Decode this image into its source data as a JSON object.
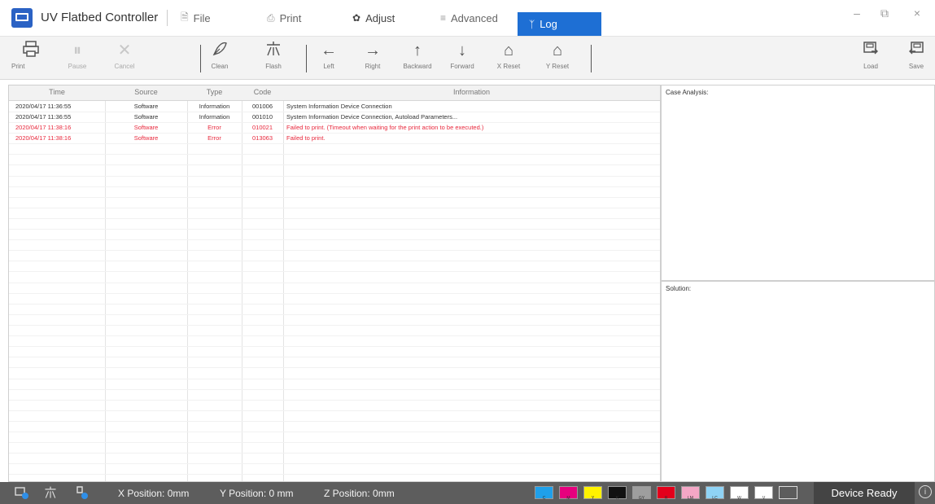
{
  "app": {
    "title": "UV Flatbed Controller",
    "logo_icon": "printer-logo-icon"
  },
  "menu": {
    "items": [
      {
        "label": "File",
        "icon": "file-icon",
        "glyph": "🗎"
      },
      {
        "label": "Print",
        "icon": "print-icon",
        "glyph": "⎙"
      },
      {
        "label": "Adjust",
        "icon": "gear-icon",
        "glyph": "✿"
      },
      {
        "label": "Advanced",
        "icon": "sliders-icon",
        "glyph": "≡"
      },
      {
        "label": "Log",
        "icon": "log-icon",
        "glyph": "ᛉ",
        "active": true
      }
    ]
  },
  "window_controls": {
    "minimize": "–",
    "restore": "⧉",
    "close": "×"
  },
  "toolbar": {
    "print": "Print",
    "pause": "Pause",
    "cancel": "Cancel",
    "clean": "Clean",
    "flash": "Flash",
    "left": "Left",
    "right": "Right",
    "backward": "Backward",
    "forward": "Forward",
    "x_reset": "X Reset",
    "y_reset": "Y Reset",
    "load": "Load",
    "save": "Save"
  },
  "log": {
    "columns": [
      "Time",
      "Source",
      "Type",
      "Code",
      "Information"
    ],
    "rows": [
      {
        "time": "2020/04/17 11:36:55",
        "source": "Software",
        "type": "Information",
        "code": "001006",
        "info": "System Information Device Connection",
        "error": false
      },
      {
        "time": "2020/04/17 11:36:55",
        "source": "Software",
        "type": "Information",
        "code": "001010",
        "info": "System Information Device Connection, Autoload Parameters...",
        "error": false
      },
      {
        "time": "2020/04/17 11:38:16",
        "source": "Software",
        "type": "Error",
        "code": "010021",
        "info": "Failed to print. (Timeout when waiting for the print action to be executed.)",
        "error": true
      },
      {
        "time": "2020/04/17 11:38:16",
        "source": "Software",
        "type": "Error",
        "code": "013063",
        "info": "Failed to print.",
        "error": true
      }
    ]
  },
  "panels": {
    "case_analysis": "Case Analysis:",
    "solution": "Solution:"
  },
  "status": {
    "x_position": "X Position: 0mm",
    "y_position": "Y Position: 0 mm",
    "z_position": "Z Position: 0mm",
    "device_status": "Device Ready",
    "inks": [
      {
        "color": "#1fa0ea",
        "label": "C"
      },
      {
        "color": "#e6007e",
        "label": "M"
      },
      {
        "color": "#fff200",
        "label": "Y"
      },
      {
        "color": "#111111",
        "label": "K"
      },
      {
        "color": "#9e9e9e",
        "label": "GY"
      },
      {
        "color": "#e3001b",
        "label": "R"
      },
      {
        "color": "#f4a7c6",
        "label": "LM"
      },
      {
        "color": "#8fd3f5",
        "label": "LC"
      },
      {
        "color": "#ffffff",
        "label": "W"
      },
      {
        "color": "#ffffff",
        "label": "V"
      },
      {
        "color": "#5d5d5d",
        "label": ""
      }
    ]
  },
  "colors": {
    "accent": "#1e6fd4",
    "error_text": "#e8283c",
    "status_bar": "#5d5d5d"
  }
}
